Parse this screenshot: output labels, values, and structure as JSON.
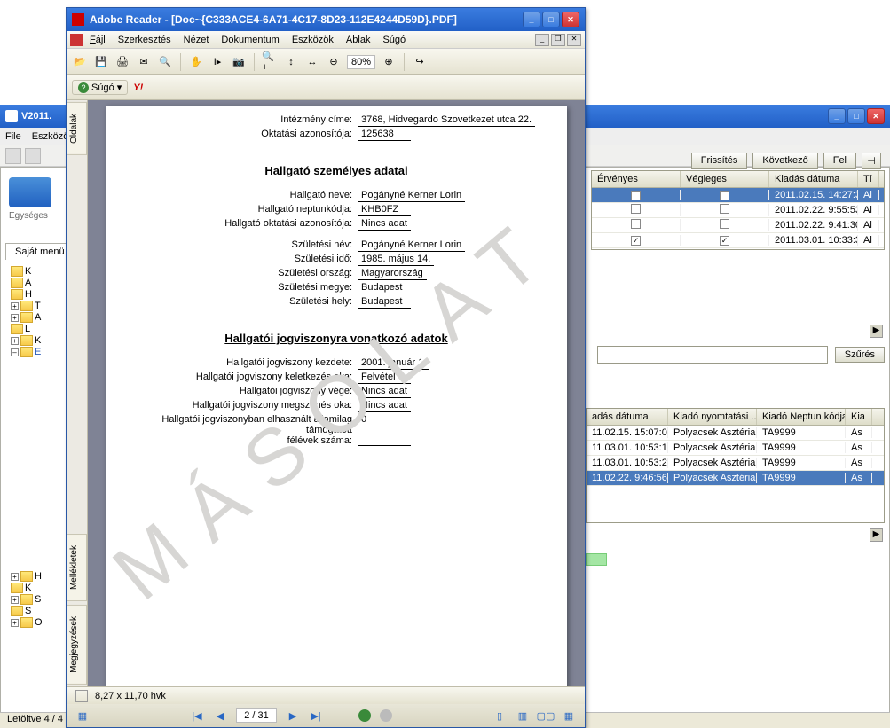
{
  "bgApp": {
    "titlePrefix": "V2011.",
    "menu": [
      "File",
      "Eszközö"
    ],
    "logoSub": "Egységes",
    "tab": "Saját menü",
    "tree": [
      "K",
      "A",
      "H",
      "T",
      "A",
      "L",
      "K",
      "E",
      "",
      "",
      "",
      "",
      "H",
      "K",
      "S",
      "S",
      "O"
    ],
    "buttons": {
      "refresh": "Frissítés",
      "next": "Következő",
      "up": "Fel",
      "filter": "Szűrés"
    },
    "grid1": {
      "headers": [
        "Érvényes",
        "Végleges",
        "Kiadás dátuma",
        "Tí"
      ],
      "rows": [
        {
          "ervenyes": "■",
          "vegleges": "■",
          "datum": "2011.02.15. 14:27:3",
          "ti": "Al",
          "selected": true
        },
        {
          "ervenyes": "",
          "vegleges": "",
          "datum": "2011.02.22. 9:55:53",
          "ti": "Al"
        },
        {
          "ervenyes": "",
          "vegleges": "",
          "datum": "2011.02.22. 9:41:30",
          "ti": "Al"
        },
        {
          "ervenyes": "✓",
          "vegleges": "✓",
          "datum": "2011.03.01. 10:33:3",
          "ti": "Al"
        }
      ]
    },
    "grid2": {
      "headers": [
        "adás dátuma",
        "Kiadó nyomtatási ...",
        "Kiadó Neptun kódja",
        "Kia"
      ],
      "rows": [
        {
          "d": "11.02.15. 15:07:0",
          "n": "Polyacsek Asztéria",
          "k": "TA9999",
          "e": "As"
        },
        {
          "d": "11.03.01. 10:53:1",
          "n": "Polyacsek Asztéria",
          "k": "TA9999",
          "e": "As"
        },
        {
          "d": "11.03.01. 10:53:2",
          "n": "Polyacsek Asztéria",
          "k": "TA9999",
          "e": "As"
        },
        {
          "d": "11.02.22. 9:46:56",
          "n": "Polyacsek Asztéria",
          "k": "TA9999",
          "e": "As",
          "selected": true
        }
      ]
    },
    "status": "Letöltve 4 / 4"
  },
  "reader": {
    "title": "Adobe Reader - [Doc~{C333ACE4-6A71-4C17-8D23-112E4244D59D}.PDF]",
    "menu": [
      "Fájl",
      "Szerkesztés",
      "Nézet",
      "Dokumentum",
      "Eszközök",
      "Ablak",
      "Súgó"
    ],
    "helpLabel": "Súgó",
    "zoom": "80%",
    "sideTabs": [
      "Oldalak",
      "Mellékletek",
      "Megjegyzések"
    ],
    "pageDim": "8,27 x 11,70 hvk",
    "pageIndicator": "2 / 31",
    "watermark": "MÁSOLAT"
  },
  "pdf": {
    "top": [
      {
        "label": "Intézmény címe:",
        "value": "3768, Hidvegardo Szovetkezet utca 22."
      },
      {
        "label": "Oktatási azonosítója:",
        "value": "125638"
      }
    ],
    "section1Title": "Hallgató személyes adatai",
    "section1": [
      {
        "label": "Hallgató neve:",
        "value": "Pogányné Kerner Lorin"
      },
      {
        "label": "Hallgató neptunkódja:",
        "value": "KHB0FZ"
      },
      {
        "label": "Hallgató oktatási azonosítója:",
        "value": "Nincs adat"
      },
      {
        "label": "Születési név:",
        "value": "Pogányné Kerner Lorin"
      },
      {
        "label": "Születési idő:",
        "value": "1985. május 14."
      },
      {
        "label": "Születési ország:",
        "value": "Magyarország"
      },
      {
        "label": "Születési megye:",
        "value": "Budapest"
      },
      {
        "label": "Születési hely:",
        "value": "Budapest"
      }
    ],
    "section2Title": "Hallgatói jogviszonyra vonatkozó adatok",
    "section2": [
      {
        "label": "Hallgatói jogviszony kezdete:",
        "value": "2001. január 1."
      },
      {
        "label": "Hallgatói jogviszony keletkezés oka:",
        "value": "Felvétel"
      },
      {
        "label": "Hallgatói jogviszony vége:",
        "value": "Nincs adat"
      },
      {
        "label": "Hallgatói jogviszony megszűnés oka:",
        "value": "Nincs adat"
      },
      {
        "label": "Hallgatói jogviszonyban elhasznált államilag támogatott félévek száma:",
        "value": "0"
      }
    ]
  }
}
